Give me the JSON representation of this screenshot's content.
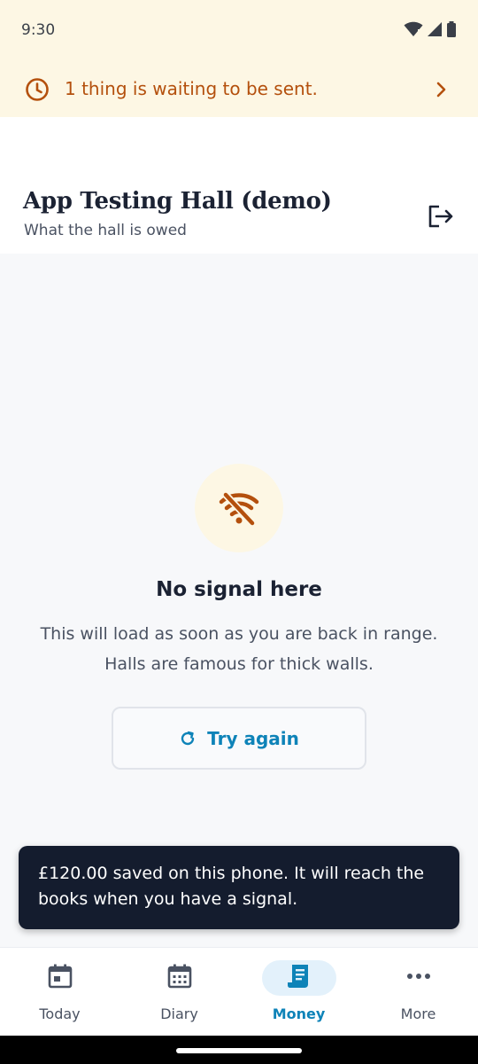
{
  "status": {
    "time": "9:30"
  },
  "banner": {
    "text": "1 thing is waiting to be sent."
  },
  "header": {
    "hall_name": "App Testing Hall (demo)",
    "subtitle": "What the hall is owed"
  },
  "empty_state": {
    "title": "No signal here",
    "body": "This will load as soon as you are back in range. Halls are famous for thick walls.",
    "retry_label": "Try again"
  },
  "toast": {
    "text": "£120.00 saved on this phone. It will reach the books when you have a signal."
  },
  "nav": {
    "items": [
      {
        "label": "Today",
        "icon": "calendar-today-icon"
      },
      {
        "label": "Diary",
        "icon": "calendar-month-icon"
      },
      {
        "label": "Money",
        "icon": "receipt-icon",
        "active": true
      },
      {
        "label": "More",
        "icon": "more-dots-icon"
      }
    ]
  },
  "colors": {
    "accent": "#0e83b8",
    "warning": "#b4500d",
    "banner_bg": "#fdf7e4",
    "toast_bg": "#141c2e"
  }
}
